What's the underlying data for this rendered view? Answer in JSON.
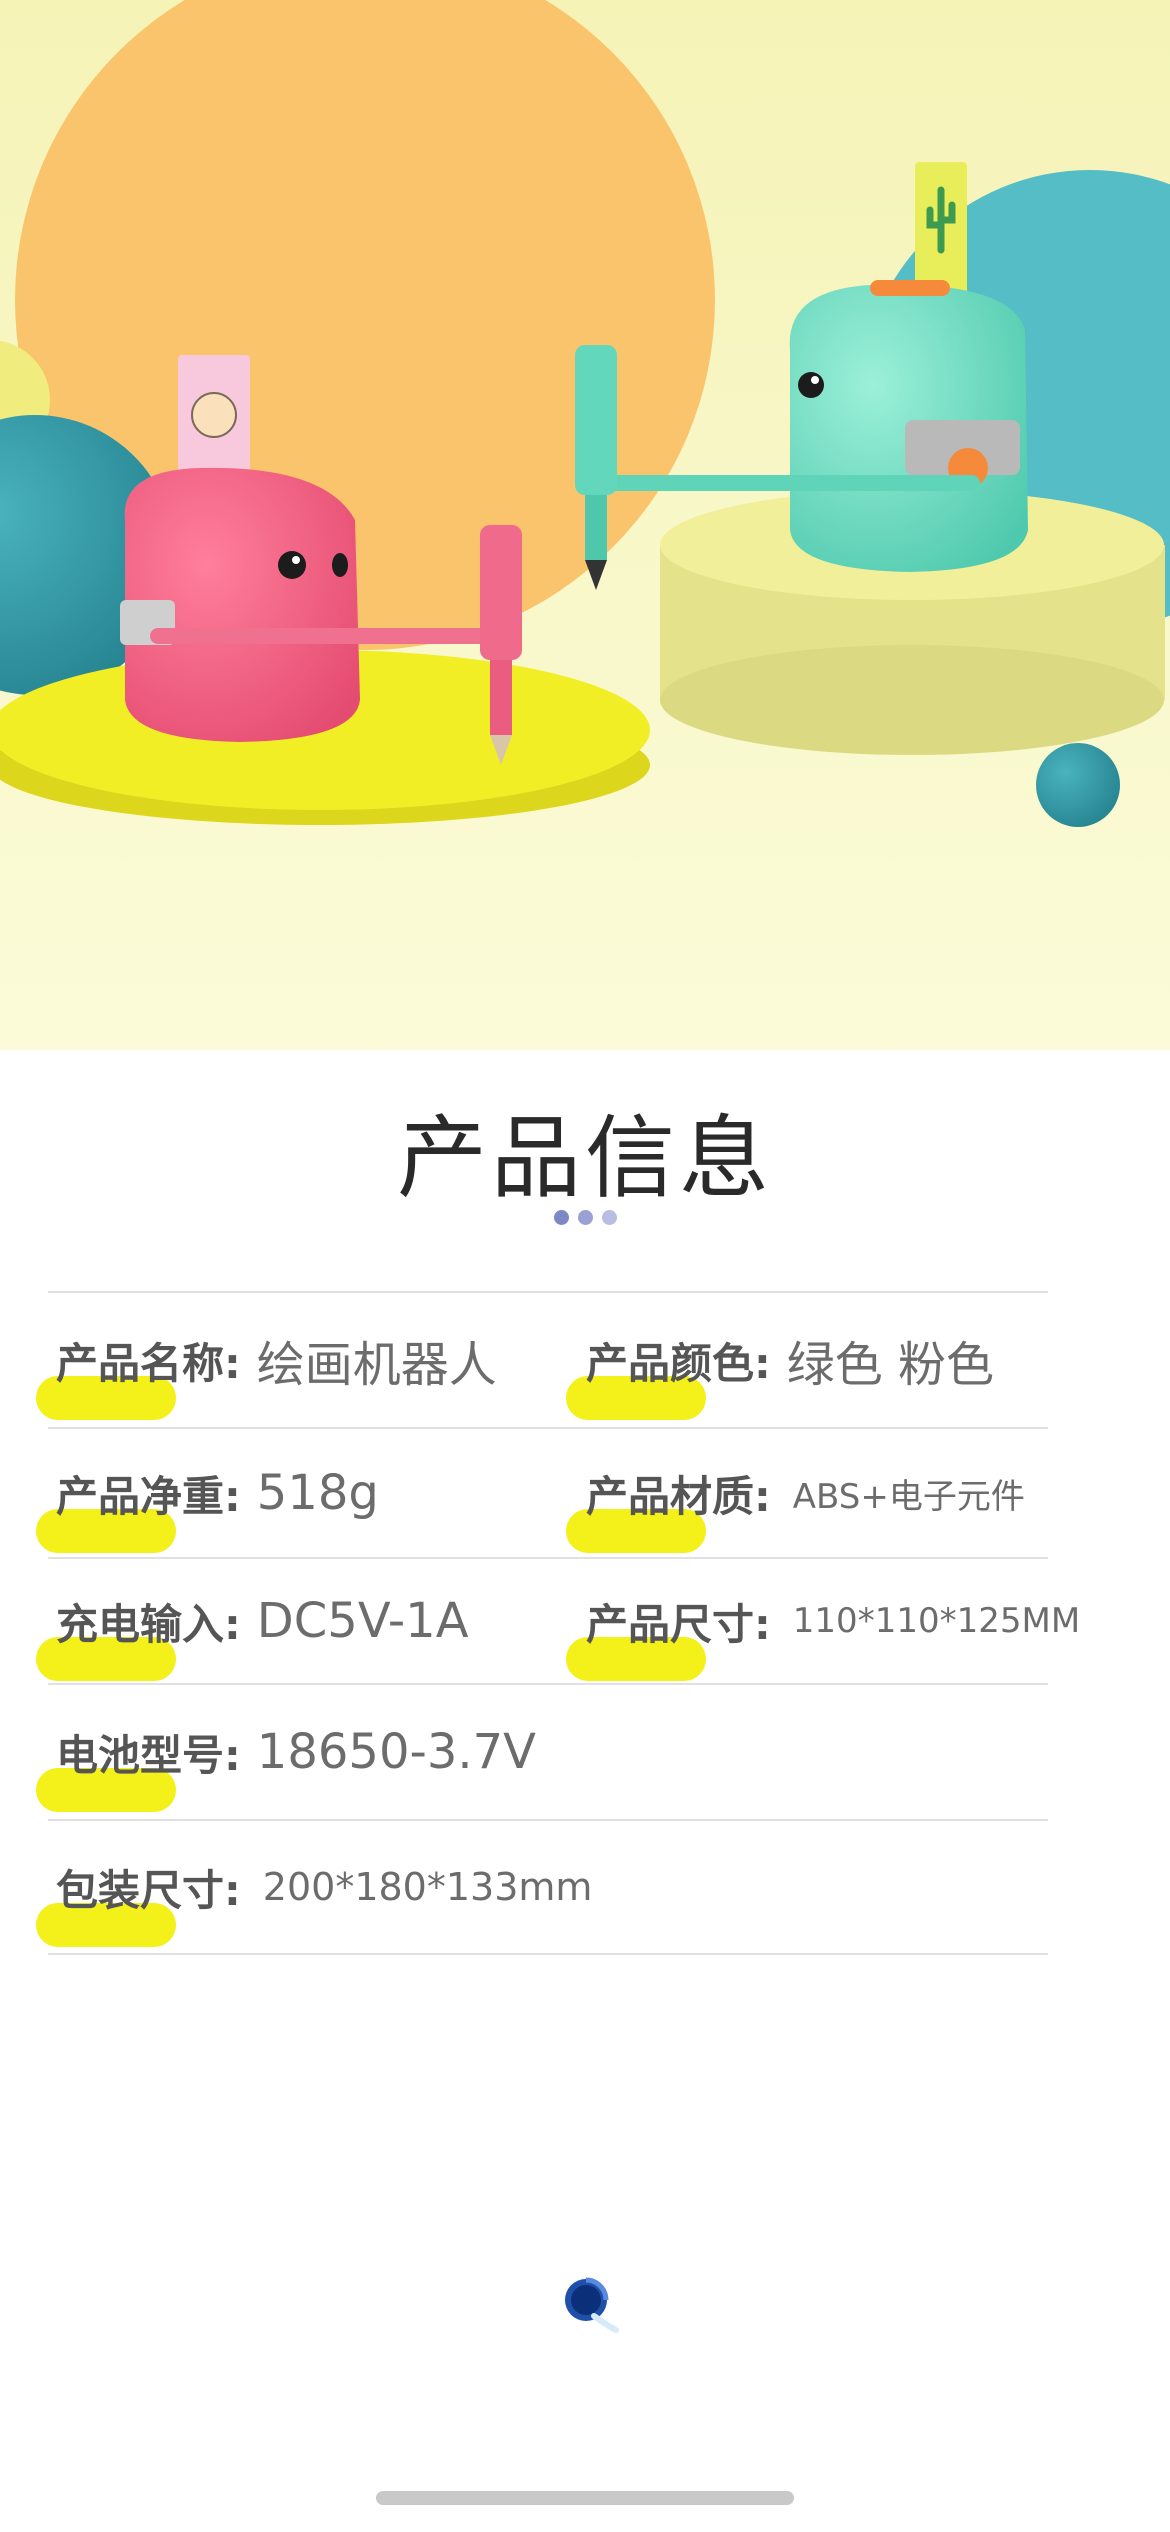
{
  "colors": {
    "highlight": "#f4f01a",
    "label": "#555555",
    "value": "#6c6c6c",
    "title": "#2a2a2a"
  },
  "section": {
    "title": "产品信息",
    "dot_colors": [
      "#7f88c7",
      "#9aa1d4",
      "#b8bde3"
    ]
  },
  "rows": [
    {
      "left": {
        "label": "产品名称:",
        "value": "绘画机器人"
      },
      "right": {
        "label": "产品颜色:",
        "value": "绿色 粉色"
      }
    },
    {
      "left": {
        "label": "产品净重:",
        "value": "518g"
      },
      "right": {
        "label": "产品材质:",
        "value": "ABS+电子元件"
      }
    },
    {
      "left": {
        "label": "充电输入:",
        "value": "DC5V-1A"
      },
      "right": {
        "label": "产品尺寸:",
        "value": "110*110*125MM"
      }
    },
    {
      "left": {
        "label": "电池型号:",
        "value": "18650-3.7V"
      }
    },
    {
      "left": {
        "label": "包装尺寸:",
        "value": "200*180*133mm"
      }
    }
  ],
  "icons": {
    "loading": "loading-spinner-icon",
    "home": "home-indicator"
  }
}
